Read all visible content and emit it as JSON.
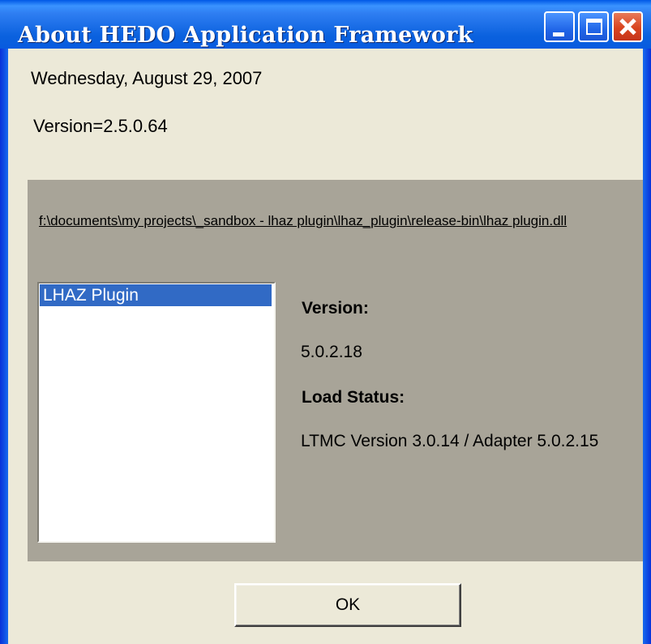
{
  "window": {
    "title": "About HEDO Application Framework",
    "controls": {
      "minimize_icon": "minimize-icon",
      "maximize_icon": "maximize-icon",
      "close_icon": "close-icon"
    },
    "title_bar_color": "#0a61de",
    "close_button_color": "#d9441f"
  },
  "header": {
    "date": "Wednesday, August 29, 2007",
    "version": "Version=2.5.0.64"
  },
  "panel": {
    "background_color": "#a8a498",
    "path": "f:\\documents\\my projects\\_sandbox - lhaz plugin\\lhaz_plugin\\release-bin\\lhaz plugin.dll",
    "plugins": [
      {
        "label": "LHAZ Plugin",
        "selected": true
      }
    ],
    "details": {
      "version_label": "Version:",
      "version_value": "5.0.2.18",
      "status_label": "Load Status:",
      "status_value": "LTMC Version 3.0.14 / Adapter 5.0.2.15"
    }
  },
  "footer": {
    "ok_label": "OK"
  },
  "colors": {
    "selection": "#316ac5",
    "dialog_background": "#ece9d8"
  }
}
